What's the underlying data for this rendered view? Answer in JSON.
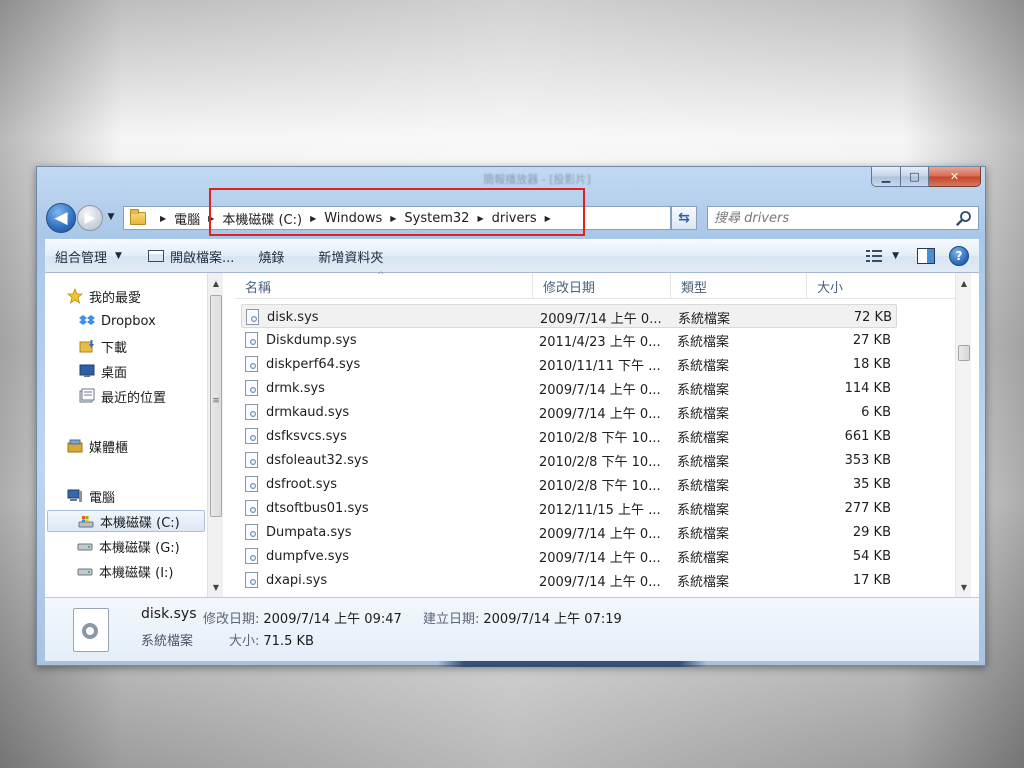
{
  "window": {
    "title": "簡報播放器 - [投影片]",
    "minimize_glyph": "▁",
    "maximize_glyph": "□",
    "close_glyph": "✕"
  },
  "address_bar": {
    "back_glyph": "◀",
    "forward_glyph": "▶",
    "recent_glyph": "▼",
    "separator_glyph": "▶",
    "dropdown_glyph": "▼",
    "refresh_glyph": "⇆",
    "breadcrumbs": [
      {
        "label": "電腦"
      },
      {
        "label": "本機磁碟 (C:)"
      },
      {
        "label": "Windows"
      },
      {
        "label": "System32"
      },
      {
        "label": "drivers"
      }
    ]
  },
  "search": {
    "placeholder": "搜尋 drivers"
  },
  "toolbar": {
    "organize_label": "組合管理",
    "open_label": "開啟檔案...",
    "burn_label": "燒錄",
    "new_folder_label": "新增資料夾",
    "caret_glyph": "▼",
    "help_glyph": "?"
  },
  "nav_pane": {
    "items": [
      {
        "label": "我的最愛",
        "icon": "star-icon"
      },
      {
        "label": "Dropbox",
        "icon": "dropbox-icon"
      },
      {
        "label": "下載",
        "icon": "download-folder-icon"
      },
      {
        "label": "桌面",
        "icon": "desktop-icon"
      },
      {
        "label": "最近的位置",
        "icon": "recent-places-icon"
      },
      {
        "label": "媒體櫃",
        "icon": "library-icon"
      },
      {
        "label": "電腦",
        "icon": "computer-icon"
      },
      {
        "label": "本機磁碟 (C:)",
        "icon": "system-drive-icon",
        "selected": true
      },
      {
        "label": "本機磁碟 (G:)",
        "icon": "drive-icon"
      },
      {
        "label": "本機磁碟 (I:)",
        "icon": "drive-icon"
      }
    ],
    "scroll_up_glyph": "▲",
    "scroll_down_glyph": "▼",
    "grip_glyph": "≡"
  },
  "file_list": {
    "columns": [
      "名稱",
      "修改日期",
      "類型",
      "大小"
    ],
    "sort_glyph": "^",
    "scroll_up_glyph": "▲",
    "scroll_down_glyph": "▼",
    "rows": [
      {
        "name": "disk.sys",
        "modified": "2009/7/14 上午 0...",
        "type": "系統檔案",
        "size": "72 KB",
        "selected": true
      },
      {
        "name": "Diskdump.sys",
        "modified": "2011/4/23 上午 0...",
        "type": "系統檔案",
        "size": "27 KB"
      },
      {
        "name": "diskperf64.sys",
        "modified": "2010/11/11 下午 ...",
        "type": "系統檔案",
        "size": "18 KB"
      },
      {
        "name": "drmk.sys",
        "modified": "2009/7/14 上午 0...",
        "type": "系統檔案",
        "size": "114 KB"
      },
      {
        "name": "drmkaud.sys",
        "modified": "2009/7/14 上午 0...",
        "type": "系統檔案",
        "size": "6 KB"
      },
      {
        "name": "dsfksvcs.sys",
        "modified": "2010/2/8 下午 10...",
        "type": "系統檔案",
        "size": "661 KB"
      },
      {
        "name": "dsfoleaut32.sys",
        "modified": "2010/2/8 下午 10...",
        "type": "系統檔案",
        "size": "353 KB"
      },
      {
        "name": "dsfroot.sys",
        "modified": "2010/2/8 下午 10...",
        "type": "系統檔案",
        "size": "35 KB"
      },
      {
        "name": "dtsoftbus01.sys",
        "modified": "2012/11/15 上午 ...",
        "type": "系統檔案",
        "size": "277 KB"
      },
      {
        "name": "Dumpata.sys",
        "modified": "2009/7/14 上午 0...",
        "type": "系統檔案",
        "size": "29 KB"
      },
      {
        "name": "dumpfve.sys",
        "modified": "2009/7/14 上午 0...",
        "type": "系統檔案",
        "size": "54 KB"
      },
      {
        "name": "dxapi.sys",
        "modified": "2009/7/14 上午 0...",
        "type": "系統檔案",
        "size": "17 KB"
      }
    ]
  },
  "details_pane": {
    "name": "disk.sys",
    "type": "系統檔案",
    "modified_label": "修改日期:",
    "modified_value": "2009/7/14 上午 09:47",
    "created_label": "建立日期:",
    "created_value": "2009/7/14 上午 07:19",
    "size_label": "大小:",
    "size_value": "71.5 KB"
  },
  "colors": {
    "highlight_box": "#e0211f",
    "window_frame": "#a9c7e8",
    "accent": "#2f6fc0"
  }
}
